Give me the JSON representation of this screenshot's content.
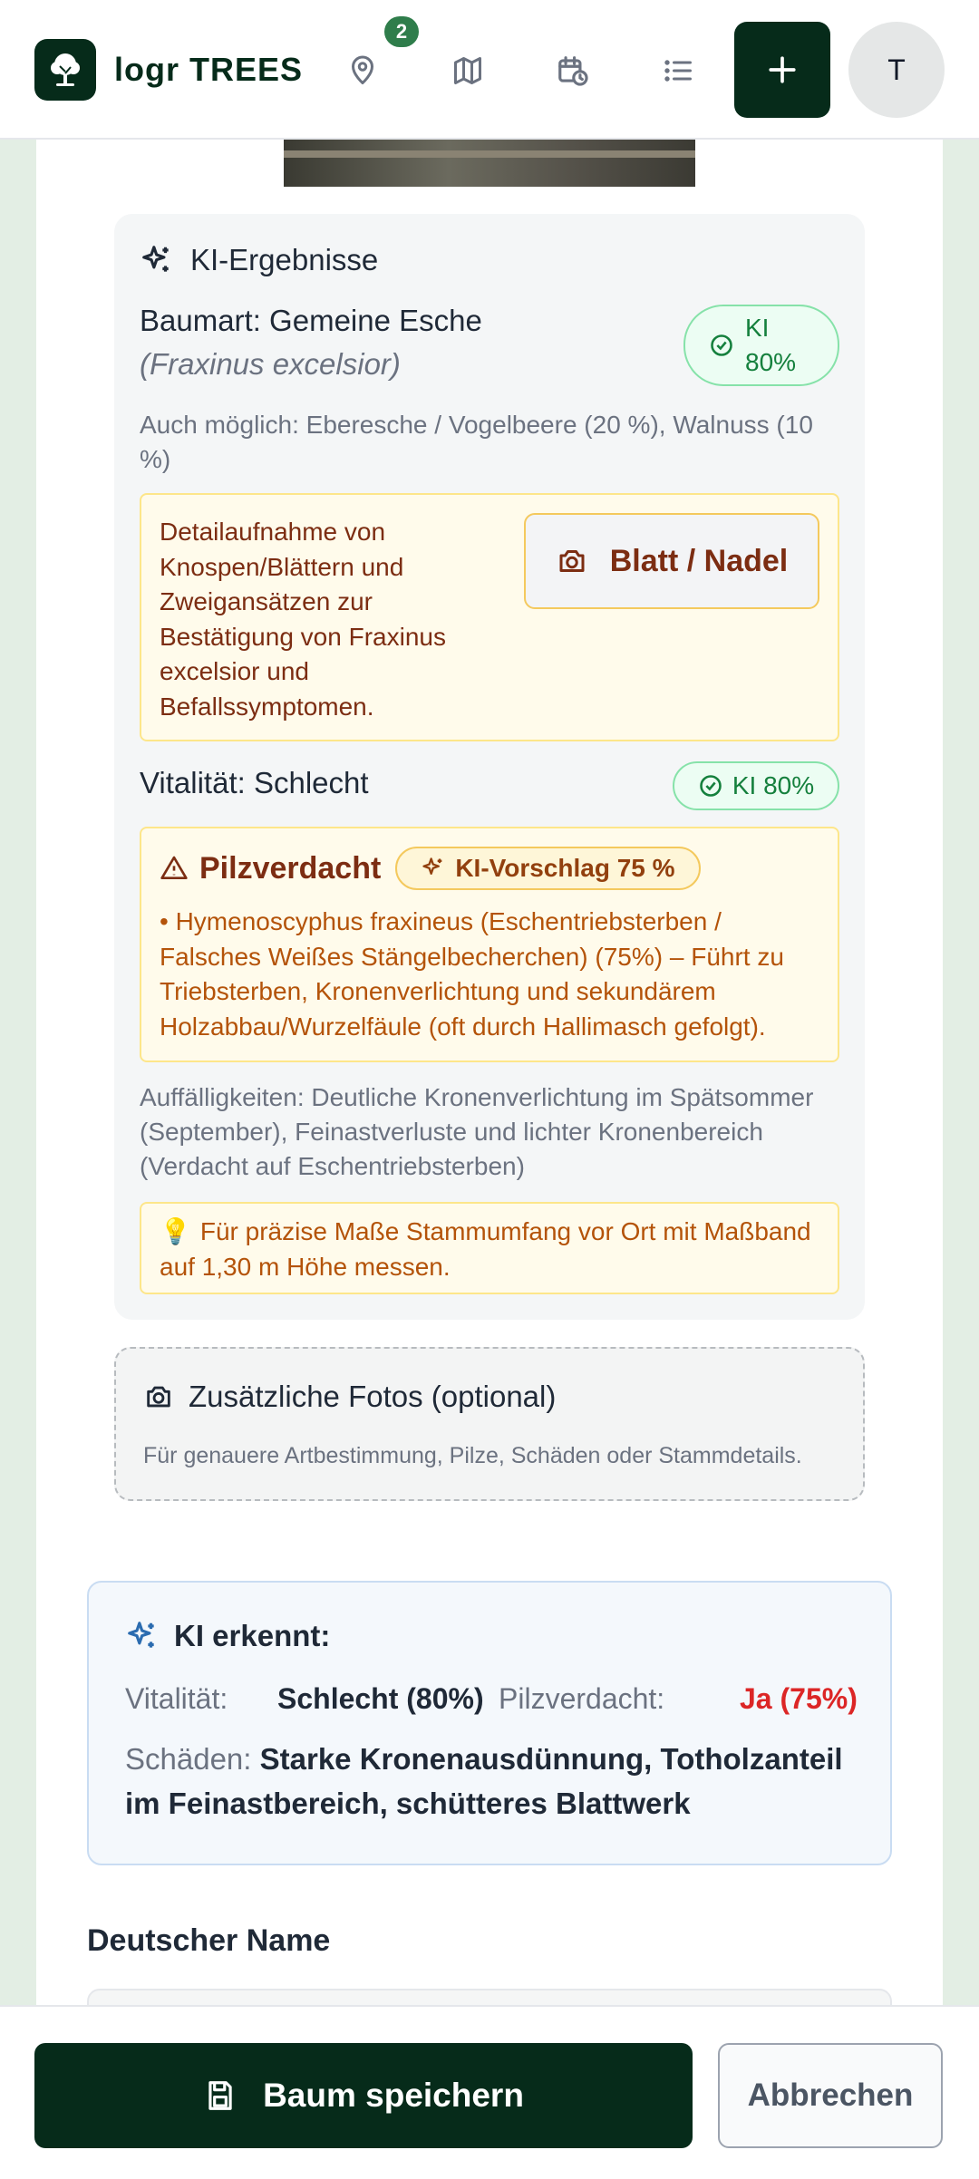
{
  "header": {
    "app_name": "logr TREES",
    "badge_count": "2",
    "avatar_initial": "T",
    "icons": [
      "tree-logo-icon",
      "map-pin-icon",
      "map-icon",
      "calendar-icon",
      "list-icon",
      "plus-icon"
    ]
  },
  "ki_card": {
    "title": "KI-Ergebnisse",
    "species_prefix": "Baumart: Gemeine Esche",
    "species_latin": "(Fraxinus excelsior)",
    "species_conf_line1": "KI",
    "species_conf_line2": "80%",
    "also_possible": "Auch möglich: Eberesche / Vogelbeere (20 %), Walnuss (10 %)",
    "hint_text": "Detailaufnahme von Knospen/Blättern und Zweigansätzen zur Bestätigung von Fraxinus excelsior und Befallssymptomen.",
    "leaf_button": "Blatt / Nadel",
    "vitality": "Vitalität: Schlecht",
    "vitality_conf": "KI 80%",
    "fungus_title": "Pilzverdacht",
    "fungus_badge": "KI-Vorschlag 75 %",
    "fungus_text": "• Hymenoscyphus fraxineus (Eschentriebsterben / Falsches Weißes Stängelbecherchen) (75%) – Führt zu Triebsterben, Kronenverlichtung und sekundärem Holzabbau/Wurzelfäule (oft durch Hallimasch gefolgt).",
    "abnormalities": "Auffälligkeiten: Deutliche Kronenverlichtung im Spätsommer (September), Feinastverluste und lichter Kronenbereich (Verdacht auf Eschentriebsterben)",
    "tip_icon": "💡",
    "tip_text": "Für präzise Maße Stammumfang vor Ort mit Maßband auf 1,30 m Höhe messen."
  },
  "fotos": {
    "title": "Zusätzliche Fotos (optional)",
    "subtitle": "Für genauere Artbestimmung, Pilze, Schäden oder Stammdetails."
  },
  "ki_erkennt": {
    "title": "KI erkennt:",
    "vitality_label": "Vitalität:",
    "vitality_value": "Schlecht (80%)",
    "fungus_label": "Pilzverdacht:",
    "fungus_value": "Ja (75%)",
    "damage_label": "Schäden:",
    "damage_value": "Starke Kronenausdünnung, Totholzanteil im Feinastbereich, schütteres Blattwerk"
  },
  "form": {
    "german_name_label": "Deutscher Name"
  },
  "footer": {
    "save_label": "Baum speichern",
    "cancel_label": "Abbrechen"
  },
  "colors": {
    "brand_dark": "#062b1a",
    "success": "#15803d",
    "warning": "#b45309",
    "danger": "#dc2626",
    "info": "#2b6cb0"
  }
}
